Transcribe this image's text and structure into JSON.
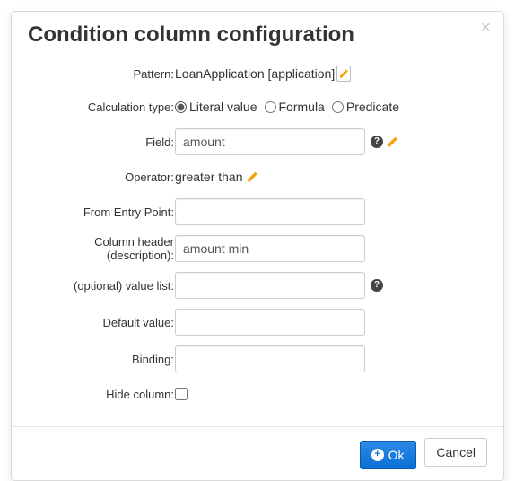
{
  "title": "Condition column configuration",
  "labels": {
    "pattern": "Pattern:",
    "calculationType": "Calculation type:",
    "field": "Field:",
    "operator": "Operator:",
    "fromEntryPoint": "From Entry Point:",
    "columnHeader": "Column header (description):",
    "valueList": "(optional) value list:",
    "defaultValue": "Default value:",
    "binding": "Binding:",
    "hideColumn": "Hide column:"
  },
  "values": {
    "pattern": "LoanApplication [application]",
    "field": "amount",
    "operator": "greater than",
    "fromEntryPoint": "",
    "columnHeader": "amount min",
    "valueList": "",
    "defaultValue": "",
    "binding": ""
  },
  "calcType": {
    "literal": "Literal value",
    "formula": "Formula",
    "predicate": "Predicate",
    "selected": "literal"
  },
  "buttons": {
    "ok": "Ok",
    "cancel": "Cancel"
  }
}
